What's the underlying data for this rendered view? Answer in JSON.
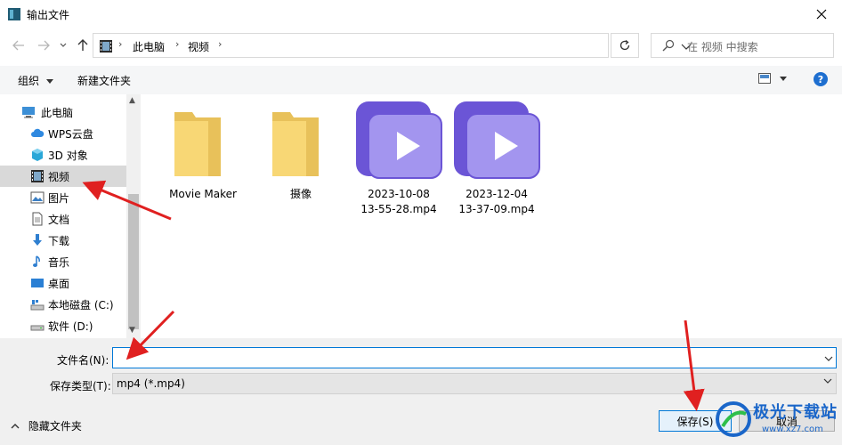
{
  "window": {
    "title": "输出文件"
  },
  "address": {
    "crumbs": [
      "此电脑",
      "视频"
    ]
  },
  "search": {
    "placeholder": "在 视频 中搜索"
  },
  "toolbar": {
    "organize": "组织",
    "new_folder": "新建文件夹",
    "help": "?"
  },
  "sidebar": {
    "items": [
      {
        "label": "此电脑",
        "icon": "computer-icon"
      },
      {
        "label": "WPS云盘",
        "icon": "cloud-icon"
      },
      {
        "label": "3D 对象",
        "icon": "cube-icon"
      },
      {
        "label": "视频",
        "icon": "video-icon",
        "selected": true
      },
      {
        "label": "图片",
        "icon": "picture-icon"
      },
      {
        "label": "文档",
        "icon": "document-icon"
      },
      {
        "label": "下载",
        "icon": "download-icon"
      },
      {
        "label": "音乐",
        "icon": "music-icon"
      },
      {
        "label": "桌面",
        "icon": "desktop-icon"
      },
      {
        "label": "本地磁盘 (C:)",
        "icon": "drive-icon"
      },
      {
        "label": "软件 (D:)",
        "icon": "drive-icon"
      }
    ]
  },
  "files": [
    {
      "name": "Movie Maker",
      "type": "folder"
    },
    {
      "name": "摄像",
      "type": "folder"
    },
    {
      "name_line1": "2023-10-08",
      "name_line2": "13-55-28.mp4",
      "type": "video"
    },
    {
      "name_line1": "2023-12-04",
      "name_line2": "13-37-09.mp4",
      "type": "video"
    }
  ],
  "form": {
    "filename_label": "文件名(N):",
    "filename_value": "",
    "filetype_label": "保存类型(T):",
    "filetype_value": "mp4 (*.mp4)"
  },
  "footer": {
    "hide_folders": "隐藏文件夹",
    "save": "保存(S)",
    "cancel": "取消"
  },
  "watermark": {
    "brand": "极光下载站",
    "url": "www.xz7.com"
  },
  "colors": {
    "accent": "#0078d7",
    "annotation": "#e02020",
    "folder": "#f8d775",
    "video": "#8b7ae6"
  }
}
